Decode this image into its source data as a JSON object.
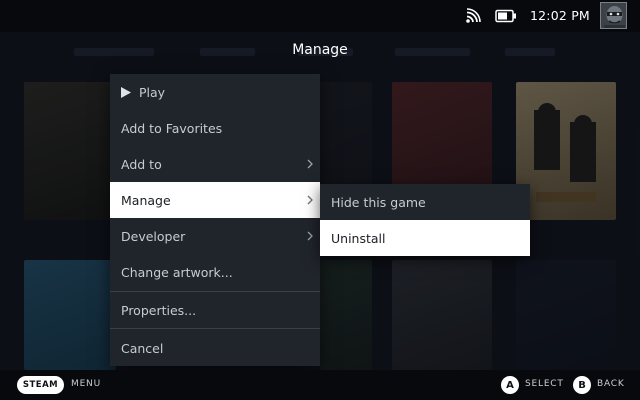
{
  "status_bar": {
    "time": "12:02 PM",
    "icons": [
      "wifi-icon",
      "battery-icon",
      "user-avatar"
    ]
  },
  "overlay": {
    "title": "Manage"
  },
  "context_menu": {
    "items": [
      {
        "label": "Play",
        "icon": "play-icon",
        "has_submenu": false,
        "active": false
      },
      {
        "label": "Add to Favorites",
        "has_submenu": false,
        "active": false
      },
      {
        "label": "Add to",
        "has_submenu": true,
        "active": false
      },
      {
        "label": "Manage",
        "has_submenu": true,
        "active": true
      },
      {
        "label": "Developer",
        "has_submenu": true,
        "active": false
      },
      {
        "label": "Change artwork...",
        "has_submenu": false,
        "active": false
      },
      {
        "label": "Properties...",
        "has_submenu": false,
        "active": false
      },
      {
        "label": "Cancel",
        "has_submenu": false,
        "active": false
      }
    ]
  },
  "submenu": {
    "items": [
      {
        "label": "Hide this game",
        "active": false
      },
      {
        "label": "Uninstall",
        "active": true
      }
    ]
  },
  "bottom_bar": {
    "steam_label": "STEAM",
    "menu_label": "MENU",
    "a_button": "A",
    "select_label": "SELECT",
    "b_button": "B",
    "back_label": "BACK"
  },
  "colors": {
    "menu_bg": "#20242b",
    "active_bg": "#ffffff",
    "bar_bg": "#07090c"
  }
}
